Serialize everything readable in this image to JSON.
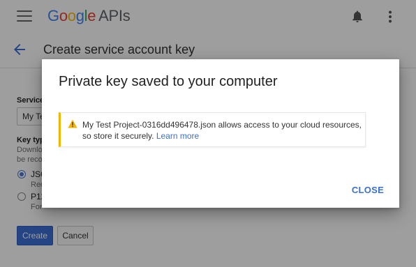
{
  "appbar": {
    "brand_letters": [
      "G",
      "o",
      "o",
      "g",
      "l",
      "e"
    ],
    "brand_suffix": "APIs",
    "icons": [
      "menu-icon",
      "bell-icon",
      "more-vert-icon"
    ]
  },
  "subheader": {
    "title": "Create service account key",
    "back_icon": "arrow-back-icon"
  },
  "form": {
    "service_label": "Service",
    "select_value": "My Te",
    "key_type_label": "Key typ",
    "key_type_desc_1": "Downlo",
    "key_type_desc_2": "be reco",
    "option_json_label": "JSO",
    "option_json_desc": "Rec",
    "option_p12_label": "P12",
    "option_p12_desc": "For",
    "create_label": "Create",
    "cancel_label": "Cancel"
  },
  "dialog": {
    "title": "Private key saved to your computer",
    "alert": {
      "icon": "warning-icon",
      "message": "My Test Project-0316dd496478.json allows access to your cloud resources, so store it securely.",
      "link_text": "Learn more"
    },
    "close_label": "CLOSE"
  },
  "colors": {
    "accent": "#3b6fd6",
    "warning": "#f4b400",
    "scrim": "rgba(0,0,0,0.38)"
  }
}
